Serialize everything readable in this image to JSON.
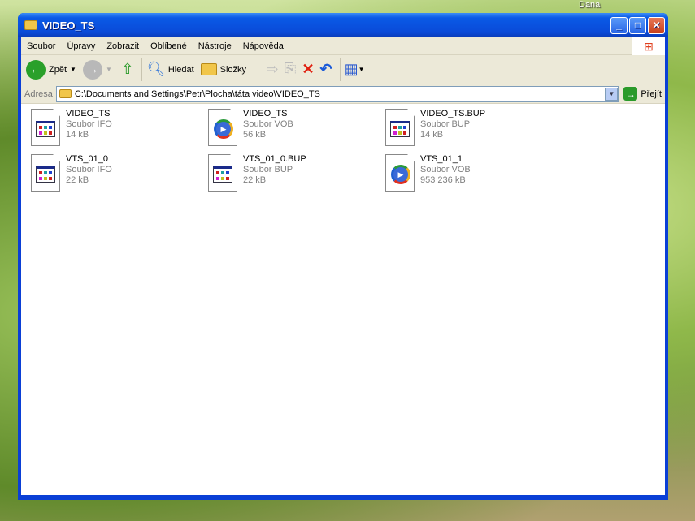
{
  "desktop": {
    "user": "Dana"
  },
  "window": {
    "title": "VIDEO_TS"
  },
  "menu": [
    "Soubor",
    "Úpravy",
    "Zobrazit",
    "Oblíbené",
    "Nástroje",
    "Nápověda"
  ],
  "toolbar": {
    "back": "Zpět",
    "search": "Hledat",
    "folders": "Složky"
  },
  "address": {
    "label": "Adresa",
    "path": "C:\\Documents and Settings\\Petr\\Plocha\\táta video\\VIDEO_TS",
    "go": "Přejít"
  },
  "files": [
    {
      "name": "VIDEO_TS",
      "type": "Soubor IFO",
      "size": "14 kB",
      "icon": "ifo"
    },
    {
      "name": "VIDEO_TS",
      "type": "Soubor VOB",
      "size": "56 kB",
      "icon": "vob"
    },
    {
      "name": "VIDEO_TS.BUP",
      "type": "Soubor BUP",
      "size": "14 kB",
      "icon": "ifo"
    },
    {
      "name": "VTS_01_0",
      "type": "Soubor IFO",
      "size": "22 kB",
      "icon": "ifo"
    },
    {
      "name": "VTS_01_0.BUP",
      "type": "Soubor BUP",
      "size": "22 kB",
      "icon": "ifo"
    },
    {
      "name": "VTS_01_1",
      "type": "Soubor VOB",
      "size": "953 236 kB",
      "icon": "vob"
    }
  ]
}
